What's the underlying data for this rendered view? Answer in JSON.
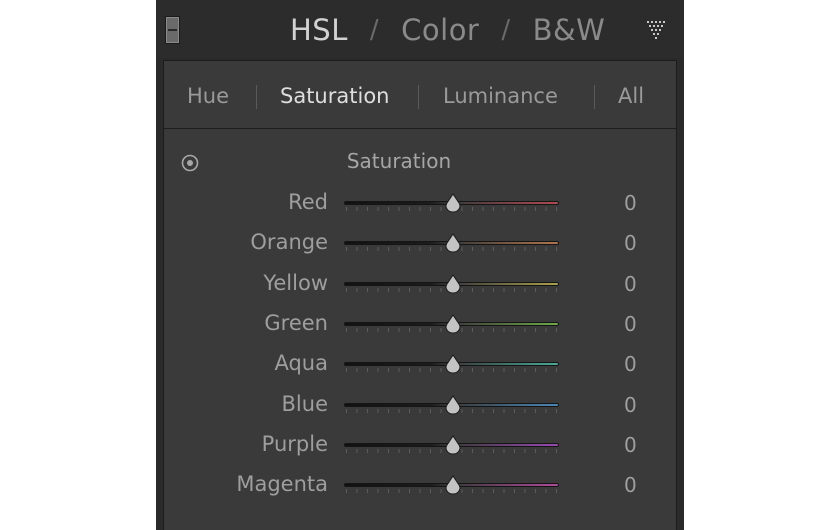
{
  "header": {
    "tabs": [
      {
        "label": "HSL",
        "active": true
      },
      {
        "label": "Color",
        "active": false
      },
      {
        "label": "B&W",
        "active": false
      }
    ],
    "separator": "/",
    "menu_icon": "triangle-menu-icon"
  },
  "subtabs": [
    {
      "label": "Hue",
      "active": false
    },
    {
      "label": "Saturation",
      "active": true
    },
    {
      "label": "Luminance",
      "active": false
    },
    {
      "label": "All",
      "active": false
    }
  ],
  "section": {
    "title": "Saturation",
    "target_icon": "target-adjust-icon"
  },
  "sliders": [
    {
      "label": "Red",
      "value": "0",
      "color": "#b04a52"
    },
    {
      "label": "Orange",
      "value": "0",
      "color": "#b0744a"
    },
    {
      "label": "Yellow",
      "value": "0",
      "color": "#aca04c"
    },
    {
      "label": "Green",
      "value": "0",
      "color": "#6fa84a"
    },
    {
      "label": "Aqua",
      "value": "0",
      "color": "#4aa89a"
    },
    {
      "label": "Blue",
      "value": "0",
      "color": "#4a86b6"
    },
    {
      "label": "Purple",
      "value": "0",
      "color": "#9a4ab0"
    },
    {
      "label": "Magenta",
      "value": "0",
      "color": "#b04a9a"
    }
  ]
}
